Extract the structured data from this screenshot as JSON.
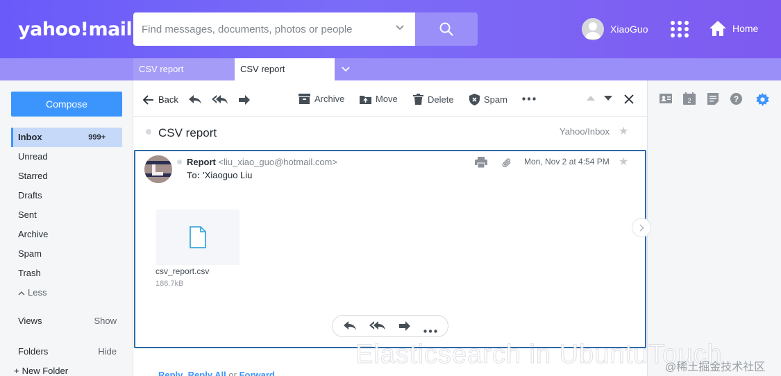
{
  "header": {
    "logo": "yahoo!mail",
    "search_placeholder": "Find messages, documents, photos or people",
    "user_name": "XiaoGuo",
    "home_label": "Home"
  },
  "tabs": [
    {
      "label": "CSV report"
    },
    {
      "label": "CSV report"
    }
  ],
  "sidebar": {
    "compose_label": "Compose",
    "folders": [
      {
        "label": "Inbox",
        "count": "999+"
      },
      {
        "label": "Unread"
      },
      {
        "label": "Starred"
      },
      {
        "label": "Drafts"
      },
      {
        "label": "Sent"
      },
      {
        "label": "Archive"
      },
      {
        "label": "Spam"
      },
      {
        "label": "Trash"
      }
    ],
    "less_label": "Less",
    "views_label": "Views",
    "views_action": "Show",
    "folders_label": "Folders",
    "folders_action": "Hide",
    "new_folder_label": "New Folder"
  },
  "toolbar": {
    "back_label": "Back",
    "archive_label": "Archive",
    "move_label": "Move",
    "delete_label": "Delete",
    "spam_label": "Spam"
  },
  "message": {
    "subject": "CSV report",
    "folder_path": "Yahoo/Inbox",
    "sender_name": "Report",
    "sender_email": "<liu_xiao_guo@hotmail.com>",
    "to_label": "To:",
    "to_value": "'Xiaoguo Liu",
    "date": "Mon, Nov 2 at 4:54 PM",
    "attachment_name": "csv_report.csv",
    "attachment_size": "186.7kB"
  },
  "quick_reply": {
    "reply": "Reply",
    "reply_all": "Reply All",
    "or": " or ",
    "forward": "Forward"
  },
  "watermark": {
    "overlay": "Elasticsearch in UbuntuTouch",
    "site": "@稀土掘金技术社区"
  },
  "colors": {
    "header_gradient_start": "#6a5af9",
    "accent_blue": "#3c95fd",
    "card_border": "#2d6aa8"
  }
}
